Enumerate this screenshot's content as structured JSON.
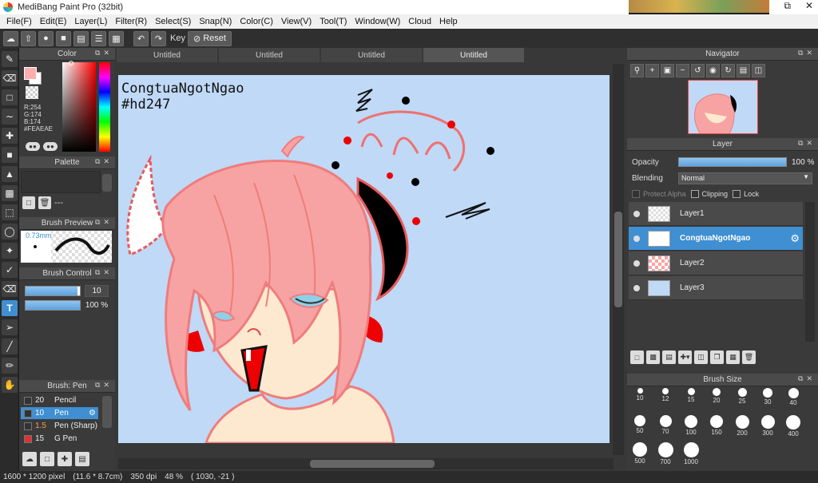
{
  "window": {
    "title": "MediBang Paint Pro (32bit)",
    "controls": [
      "⧉",
      "✕"
    ]
  },
  "video_overlay": {
    "icons": [
      "chevron-up-icon",
      "mic-off-icon",
      "camera-icon",
      "share-icon"
    ]
  },
  "menubar": [
    "File(F)",
    "Edit(E)",
    "Layer(L)",
    "Filter(R)",
    "Select(S)",
    "Snap(N)",
    "Color(C)",
    "View(V)",
    "Tool(T)",
    "Window(W)",
    "Cloud",
    "Help"
  ],
  "toolbar": {
    "key_label": "Key",
    "reset_label": "Reset"
  },
  "color_panel": {
    "title": "Color",
    "r": "R:254",
    "g": "G:174",
    "b": "B:174",
    "hex": "#FEAEAE",
    "current_color": "#FEAEAE"
  },
  "palette_panel": {
    "title": "Palette",
    "empty": "---"
  },
  "brush_preview": {
    "title": "Brush Preview",
    "size": "0.73mm"
  },
  "brush_control": {
    "title": "Brush Control",
    "size_value": "10",
    "opacity_value": "100 %",
    "size_fraction": 0.95,
    "opacity_fraction": 1.0
  },
  "brush_list": {
    "title": "Brush: Pen",
    "items": [
      {
        "size": "20",
        "name": "Pencil",
        "color": "#333333"
      },
      {
        "size": "10",
        "name": "Pen",
        "color": "#333333"
      },
      {
        "size": "1.5",
        "name": "Pen (Sharp)",
        "color": "#333333"
      },
      {
        "size": "15",
        "name": "G Pen",
        "color": "#e03030"
      }
    ]
  },
  "doc_tabs": [
    "Untitled",
    "Untitled",
    "Untitled",
    "Untitled"
  ],
  "canvas": {
    "signature_line1": "CongtuaNgotNgao",
    "signature_line2": "#hd247"
  },
  "navigator": {
    "title": "Navigator"
  },
  "layer_panel": {
    "title": "Layer",
    "opacity_label": "Opacity",
    "opacity_value": "100 %",
    "blending_label": "Blending",
    "blending_value": "Normal",
    "protect_alpha": "Protect Alpha",
    "clipping": "Clipping",
    "lock": "Lock",
    "layers": [
      {
        "name": "Layer1"
      },
      {
        "name": "CongtuaNgotNgao"
      },
      {
        "name": "Layer2"
      },
      {
        "name": "Layer3"
      }
    ]
  },
  "brush_size": {
    "title": "Brush Size",
    "sizes": [
      "10",
      "12",
      "15",
      "20",
      "25",
      "30",
      "40",
      "50",
      "70",
      "100",
      "150",
      "200",
      "300",
      "400",
      "500",
      "700",
      "1000"
    ]
  },
  "statusbar": {
    "dimensions": "1600 * 1200 pixel",
    "physical": "(11.6 * 8.7cm)",
    "dpi": "350 dpi",
    "zoom": "48 %",
    "coords": "( 1030, -21 )"
  }
}
